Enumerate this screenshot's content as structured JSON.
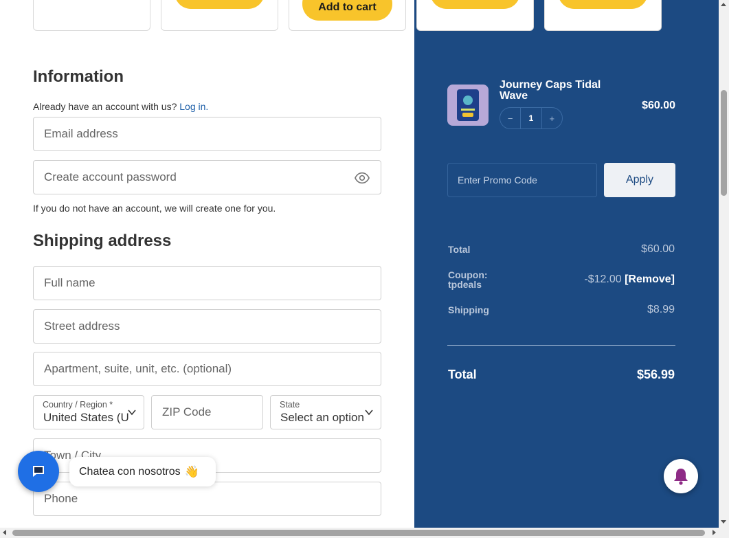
{
  "top_cards": {
    "add_to_cart_label": "Add to cart"
  },
  "information": {
    "heading": "Information",
    "have_account_text": "Already have an account with us?",
    "login_link": "Log in.",
    "email_placeholder": "Email address",
    "password_placeholder": "Create account password",
    "note": "If you do not have an account, we will create one for you."
  },
  "shipping": {
    "heading": "Shipping address",
    "full_name_placeholder": "Full name",
    "street_placeholder": "Street address",
    "apartment_placeholder": "Apartment, suite, unit, etc. (optional)",
    "country_label": "Country / Region *",
    "country_value": "United States (U",
    "zip_placeholder": "ZIP Code",
    "state_label": "State",
    "state_value": "Select an option",
    "city_placeholder": "Town / City",
    "phone_placeholder": "Phone"
  },
  "chat": {
    "label": "Chatea con nosotros",
    "wave_emoji": "👋"
  },
  "order": {
    "product_name": "Journey Caps Tidal Wave",
    "quantity": "1",
    "minus": "−",
    "plus": "+",
    "price": "$60.00",
    "promo_placeholder": "Enter Promo Code",
    "apply_label": "Apply",
    "total_label": "Total",
    "total_value": "$60.00",
    "coupon_label_1": "Coupon:",
    "coupon_label_2": "tpdeals",
    "coupon_value": "-$12.00",
    "remove_label": "[Remove]",
    "shipping_label": "Shipping",
    "shipping_value": "$8.99",
    "grand_total_label": "Total",
    "grand_total_value": "$56.99"
  },
  "colors": {
    "panel_bg": "#1c4a82",
    "cart_button": "#f8c42b",
    "chat_button": "#1f6fe5",
    "link": "#1d5fa8"
  }
}
